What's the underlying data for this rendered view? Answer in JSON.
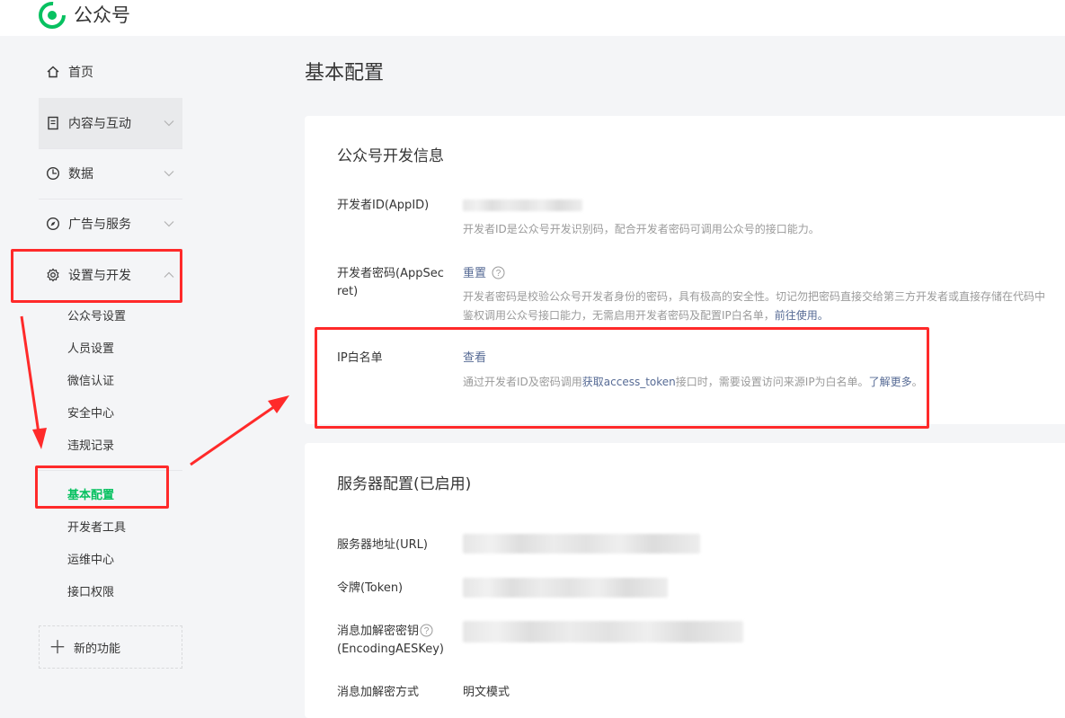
{
  "brand": {
    "name": "公众号",
    "logo_icon": "wechat-official-account-logo-icon"
  },
  "colors": {
    "accent": "#07c160",
    "link": "#576b95",
    "annotation": "#ff2a2a"
  },
  "sidebar": {
    "home": "首页",
    "content": "内容与互动",
    "data": "数据",
    "ads": "广告与服务",
    "settings": "设置与开发",
    "sub_items": [
      "公众号设置",
      "人员设置",
      "微信认证",
      "安全中心",
      "违规记录",
      "基本配置",
      "开发者工具",
      "运维中心",
      "接口权限"
    ],
    "new_feature": "新的功能"
  },
  "main": {
    "page_title": "基本配置",
    "dev_info": {
      "title": "公众号开发信息",
      "appid_label": "开发者ID(AppID)",
      "appid_desc": "开发者ID是公众号开发识别码，配合开发者密码可调用公众号的接口能力。",
      "secret_label_1": "开发者密码(AppSec",
      "secret_label_2": "ret)",
      "secret_action": "重置",
      "secret_desc_1": "开发者密码是校验公众号开发者身份的密码，具有极高的安全性。切记勿把密码直接交给第三方开发者或直接存储在代码中",
      "secret_desc_2a": "鉴权调用公众号接口能力，无需启用开发者密码及配置IP白名单，",
      "secret_desc_2b": "前往使用。",
      "ip_label": "IP白名单",
      "ip_action": "查看",
      "ip_desc_1": "通过开发者ID及密码调用",
      "ip_desc_link1": "获取access_token",
      "ip_desc_2": "接口时，需要设置访问来源IP为白名单。",
      "ip_desc_link2": "了解更多"
    },
    "server": {
      "title": "服务器配置(已启用)",
      "url_label": "服务器地址(URL)",
      "token_label": "令牌(Token)",
      "aes_label_1": "消息加解密密钥",
      "aes_label_2": "(EncodingAESKey)",
      "mode_label": "消息加解密方式",
      "mode_value": "明文模式"
    }
  }
}
